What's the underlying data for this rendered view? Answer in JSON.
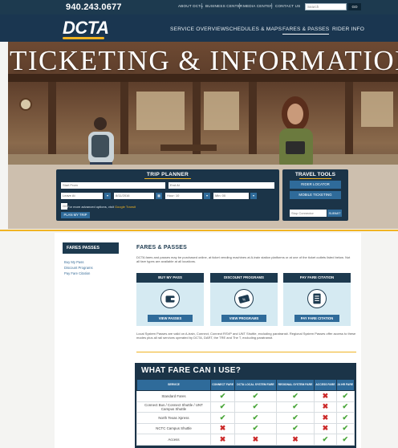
{
  "header": {
    "phone": "940.243.0677",
    "util_links": [
      "ABOUT DCTA",
      "BUSINESS CENTER",
      "MEDIA CENTER",
      "CONTACT US"
    ],
    "search_placeholder": "Search",
    "search_go": "GO",
    "logo": "DCTA",
    "nav": [
      "SERVICE OVERVIEW",
      "SCHEDULES & MAPS",
      "FARES & PASSES",
      "RIDER INFO"
    ],
    "active_nav": "FARES & PASSES"
  },
  "hero": {
    "title": "TICKETING & INFORMATION"
  },
  "trip_planner": {
    "title": "TRIP PLANNER",
    "start_placeholder": "Start From",
    "end_placeholder": "End At",
    "leave_label": "Leave At",
    "date_value": "8/11/2016",
    "hour_value": "Hour: 10",
    "min_value": "Min: 00",
    "go_label": "GO",
    "note_text": "For more advanced options, visit",
    "note_link": "Google Transit",
    "plan_button": "PLAN MY TRIP"
  },
  "travel_tools": {
    "title": "TRAVEL TOOLS",
    "buttons": [
      "RIDER LOCATOR",
      "MOBILE TICKETING"
    ],
    "input_placeholder": "Stop Connector",
    "submit_label": "SUBMIT"
  },
  "sidebar": {
    "heading": "FARES PASSES",
    "links": [
      "Buy My Pass",
      "Discount Programs",
      "Pay Fare Citation"
    ]
  },
  "main": {
    "title": "FARES & PASSES",
    "intro": "DCTA fares and passes may be purchased online, at ticket vending machines at A-train station platforms or at one of the ticket outlets listed below. Not all fare types are available at all locations.",
    "cards": [
      {
        "title": "BUY MY PASS",
        "button": "VIEW PASSES"
      },
      {
        "title": "DISCOUNT PROGRAMS",
        "button": "VIEW PROGRAMS"
      },
      {
        "title": "PAY FARE CITATION",
        "button": "PAY FARE CITATION"
      }
    ],
    "note": "Local System Passes are valid on A-train, Connect, Connect RSVP and UNT Shuttle, excluding paratransit. Regional System Passes offer access to these modes plus all rail services operated by DCTA, DART, the TRE and The T, excluding paratransit.",
    "fare_title": "WHAT FARE CAN I USE?",
    "fare_table": {
      "headers": [
        "SERVICE",
        "CONNECT FARE",
        "DCTA LOCAL SYSTEM FARE",
        "REGIONAL SYSTEM FARE",
        "ACCESS FARE",
        "24 HR FARE"
      ],
      "rows": [
        {
          "service": "Standard Fares",
          "marks": [
            "check",
            "check",
            "check",
            "x",
            "check"
          ]
        },
        {
          "service": "Connect Bus / Connect Shuttle / UNT Campus Shuttle",
          "marks": [
            "check",
            "check",
            "check",
            "x",
            "check"
          ]
        },
        {
          "service": "North Texas Xpress",
          "marks": [
            "check",
            "check",
            "check",
            "x",
            "check"
          ]
        },
        {
          "service": "NCTC Campus Shuttle",
          "marks": [
            "x",
            "check",
            "check",
            "x",
            "check"
          ]
        },
        {
          "service": "Access",
          "marks": [
            "x",
            "x",
            "x",
            "check",
            "check"
          ]
        }
      ]
    }
  }
}
